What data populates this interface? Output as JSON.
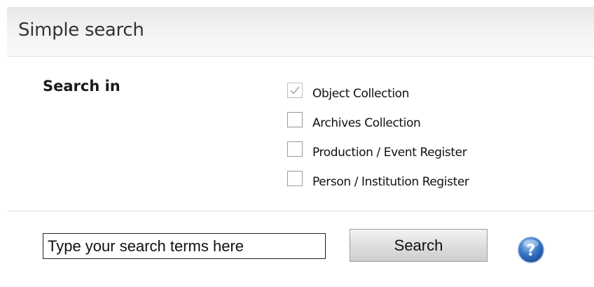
{
  "panel": {
    "title": "Simple search"
  },
  "search_in": {
    "label": "Search in",
    "options": [
      {
        "label": "Object Collection",
        "checked": true
      },
      {
        "label": "Archives Collection",
        "checked": false
      },
      {
        "label": "Production / Event Register",
        "checked": false
      },
      {
        "label": "Person / Institution Register",
        "checked": false
      }
    ]
  },
  "search": {
    "placeholder": "Type your search terms here",
    "value": "",
    "button_label": "Search",
    "help_icon": "question-mark-help-icon"
  },
  "colors": {
    "help_icon_blue": "#3b78c8",
    "header_gradient_top": "#e8e8e8"
  }
}
